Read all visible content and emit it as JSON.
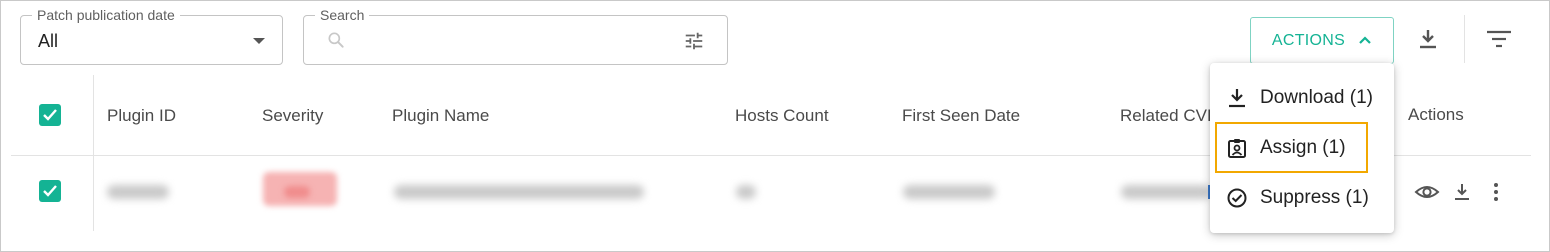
{
  "filters": {
    "date": {
      "label": "Patch publication date",
      "value": "All"
    },
    "search": {
      "label": "Search",
      "value": ""
    }
  },
  "toolbar": {
    "actions_label": "ACTIONS",
    "icons": [
      "chevron-up-icon",
      "download-icon",
      "filter-list-icon"
    ]
  },
  "table": {
    "headers": [
      "Plugin ID",
      "Severity",
      "Plugin Name",
      "Hosts Count",
      "First Seen Date",
      "Related CVI",
      "Actions"
    ],
    "rows": [
      {
        "selected": true,
        "redacted": true,
        "row_actions": [
          "view-icon",
          "download-icon",
          "more-vert-icon"
        ]
      }
    ]
  },
  "dropdown": {
    "items": [
      {
        "label": "Download (1)",
        "icon": "download-icon"
      },
      {
        "label": "Assign (1)",
        "icon": "assign-icon",
        "highlighted": true
      },
      {
        "label": "Suppress (1)",
        "icon": "check-circle-icon"
      }
    ]
  },
  "colors": {
    "accent": "#14b394",
    "highlight": "#f2a800",
    "border": "#c4c4c4"
  }
}
